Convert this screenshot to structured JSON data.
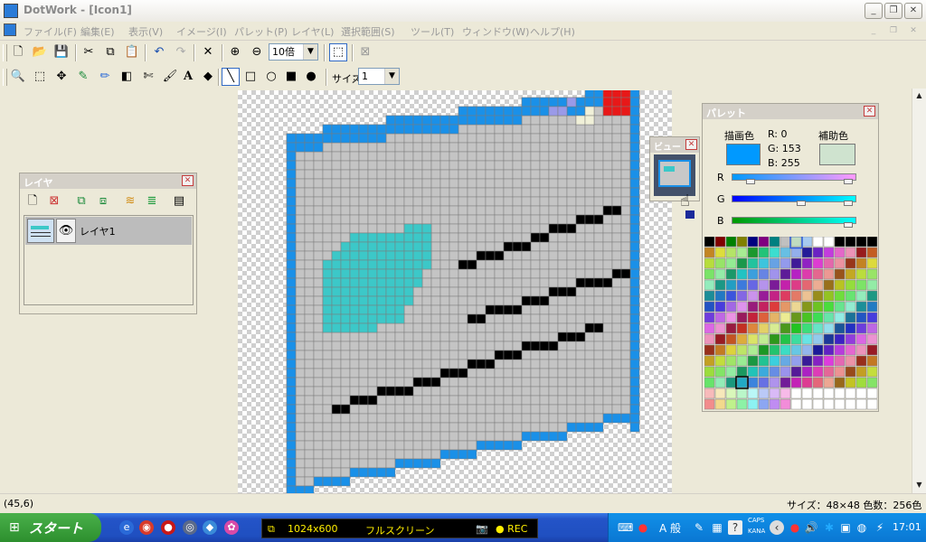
{
  "window": {
    "title": "DotWork - [Icon1]",
    "min": "_",
    "restore": "❐",
    "close": "✕"
  },
  "menu": [
    "ファイル(F)",
    "編集(E)",
    "表示(V)",
    "イメージ(I)",
    "パレット(P)",
    "レイヤ(L)",
    "選択範囲(S)",
    "ツール(T)",
    "ウィンドウ(W)",
    "ヘルプ(H)"
  ],
  "toolbar1": {
    "zoom_value": "10倍"
  },
  "toolbar2": {
    "size_label": "サイズ",
    "size_value": "1",
    "text_tool": "A"
  },
  "layer_panel": {
    "title": "レイヤ",
    "layers": [
      {
        "name": "レイヤ1"
      }
    ]
  },
  "view_panel": {
    "title": "ビュー"
  },
  "palette_panel": {
    "title": "パレット",
    "fg_label": "描画色",
    "bg_label": "補助色",
    "r_text": "R: 0",
    "g_text": "G: 153",
    "b_text": "B: 255",
    "r_label": "R",
    "g_label": "G",
    "b_label": "B",
    "fg_color": "#0099ff",
    "bg_color": "#cfe3cf"
  },
  "status": {
    "coords": "(45,6)",
    "info": "サイズ：48×48 色数：256色"
  },
  "taskbar": {
    "start_label": "スタート",
    "resolution": "1024x600",
    "mode": "フルスクリーン",
    "rec": "● REC",
    "ime": "A 般",
    "caps": "CAPS",
    "kana": "KANA",
    "clock": "17:01"
  },
  "colors": {
    "grid_gray": "#c4c4c4",
    "blue": "#1a90e8",
    "cyan": "#3cc8c8",
    "red": "#e81818",
    "lavender": "#9a9ae8"
  }
}
